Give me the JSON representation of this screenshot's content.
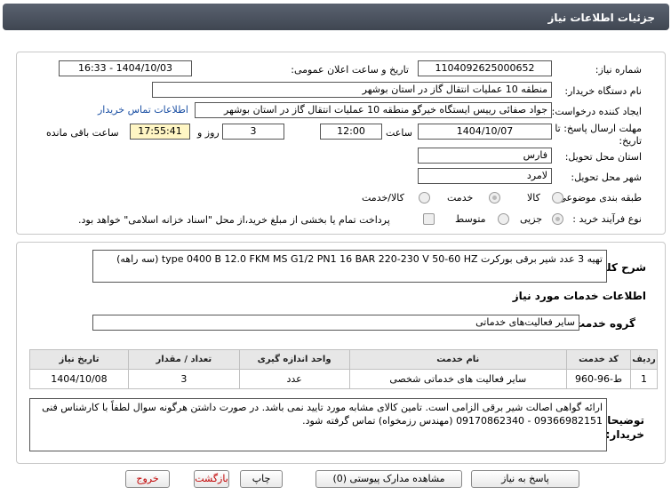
{
  "header": {
    "title": "جزئیات اطلاعات نیاز"
  },
  "form": {
    "need_number_label": "شماره نیاز:",
    "need_number": "1104092625000652",
    "announce_label": "تاریخ و ساعت اعلان عمومی:",
    "announce_value": "1404/10/03 - 16:33",
    "buyer_label": "نام دستگاه خریدار:",
    "buyer_value": "منطقه 10 عملیات انتقال گاز در استان بوشهر",
    "creator_label": "ایجاد کننده درخواست:",
    "creator_value": "جواد صفائی رییس ایستگاه خیرگو منطقه 10 عملیات انتقال گاز در استان بوشهر",
    "contact_link": "اطلاعات تماس خریدار",
    "deadline_label_1": "مهلت ارسال پاسخ: تا",
    "deadline_label_2": "تاریخ:",
    "deadline_date": "1404/10/07",
    "time_label": "ساعت",
    "deadline_time": "12:00",
    "days_value": "3",
    "days_label": "روز و",
    "remaining_time": "17:55:41",
    "remaining_label": "ساعت باقی مانده",
    "province_label": "استان محل تحویل:",
    "province_value": "فارس",
    "city_label": "شهر محل تحویل:",
    "city_value": "لامرد",
    "category_label": "طبقه بندی موضوعی:",
    "category_options": [
      "کالا",
      "خدمت",
      "کالا/خدمت"
    ],
    "category_selected": "خدمت",
    "process_label": "نوع فرآیند خرید :",
    "process_options": [
      "جزیی",
      "متوسط"
    ],
    "process_selected": "جزیی",
    "payment_note": "پرداخت تمام یا بخشی از مبلغ خرید،از محل \"اسناد خزانه اسلامی\" خواهد بود."
  },
  "description": {
    "label": "شرح کلی نیاز:",
    "value": "تهیه 3 عدد شیر برقی بورکرت type 0400 B 12.0 FKM MS G1/2 PN1 16 BAR 220-230 V 50-60 HZ (سه راهه)"
  },
  "services": {
    "section_title": "اطلاعات خدمات مورد نیاز",
    "group_label": "گروه خدمت:",
    "group_value": "سایر فعالیت‌های خدماتی",
    "columns": [
      "ردیف",
      "کد خدمت",
      "نام خدمت",
      "واحد اندازه گیری",
      "تعداد / مقدار",
      "تاریخ نیاز"
    ],
    "rows": [
      [
        "1",
        "ط-96-960",
        "سایر فعالیت های خدماتی شخصی",
        "عدد",
        "3",
        "1404/10/08"
      ]
    ]
  },
  "notes": {
    "label_1": "توضیحات",
    "label_2": "خریدار:",
    "value": "ارائه گواهی اصالت شیر برقی الزامی است. تامین کالای مشابه مورد تایید نمی باشد. در صورت داشتن هرگونه سوال لطفاً با کارشناس فنی 09366982151 - 09170862340 (مهندس رزمخواه) تماس گرفته شود."
  },
  "buttons": {
    "reply": "پاسخ به نیاز",
    "docs": "مشاهده مدارک پیوستی (0)",
    "print": "چاپ",
    "back": "بازگشت",
    "exit": "خروج"
  },
  "colors": {
    "header_bg": "#4a515c",
    "link": "#1a4fa3",
    "highlight": "#fff6c4",
    "danger": "#c00000"
  }
}
